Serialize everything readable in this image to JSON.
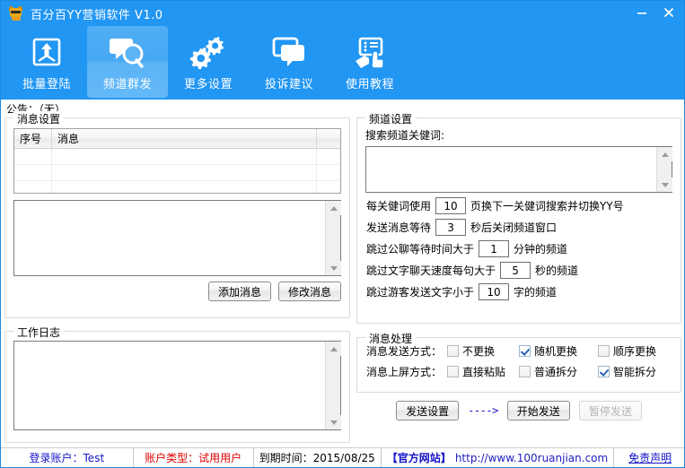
{
  "window": {
    "title": "百分百YY营销软件 V1.0",
    "app_icon": "cat-face-icon",
    "minimize": "minimize-icon",
    "close": "close-icon"
  },
  "toolbar": {
    "items": [
      {
        "label": "批量登陆",
        "icon": "upload-box-icon",
        "selected": false
      },
      {
        "label": "频道群发",
        "icon": "chat-search-icon",
        "selected": true
      },
      {
        "label": "更多设置",
        "icon": "gears-icon",
        "selected": false
      },
      {
        "label": "投诉建议",
        "icon": "speech-bubbles-icon",
        "selected": false
      },
      {
        "label": "使用教程",
        "icon": "hand-screen-icon",
        "selected": false
      }
    ]
  },
  "notice": {
    "text": "公告：（无）"
  },
  "message_settings": {
    "title": "消息设置",
    "table": {
      "columns": [
        "序号",
        "消息",
        ""
      ],
      "rows": [
        [
          "",
          "",
          ""
        ],
        [
          "",
          "",
          ""
        ],
        [
          "",
          "",
          ""
        ]
      ]
    },
    "editor": {
      "value": "",
      "placeholder": ""
    },
    "add_button": "添加消息",
    "edit_button": "修改消息"
  },
  "work_log": {
    "title": "工作日志",
    "value": ""
  },
  "channel_settings": {
    "title": "频道设置",
    "keyword_label": "搜索频道关健词:",
    "keyword_value": "",
    "rows": [
      {
        "prefix": "每关健词使用",
        "value": "10",
        "suffix": "页换下一关健词搜索并切换YY号"
      },
      {
        "prefix": "发送消息等待",
        "value": "3",
        "suffix": "秒后关闭频道窗口"
      },
      {
        "prefix": "跳过公聊等待时间大于",
        "value": "1",
        "suffix": "分钟的频道"
      },
      {
        "prefix": "跳过文字聊天速度每句大于",
        "value": "5",
        "suffix": "秒的频道"
      },
      {
        "prefix": "跳过游客发送文字小于",
        "value": "10",
        "suffix": "字的频道"
      }
    ]
  },
  "message_processing": {
    "title": "消息处理",
    "send_mode": {
      "label": "消息发送方式：",
      "options": [
        {
          "label": "不更换",
          "checked": false
        },
        {
          "label": "随机更换",
          "checked": true
        },
        {
          "label": "顺序更换",
          "checked": false
        }
      ]
    },
    "display_mode": {
      "label": "消息上屏方式：",
      "options": [
        {
          "label": "直接粘贴",
          "checked": false
        },
        {
          "label": "普通拆分",
          "checked": false
        },
        {
          "label": "智能拆分",
          "checked": true
        }
      ]
    },
    "send_settings_button": "发送设置",
    "arrow": "---->",
    "start_button": "开始发送",
    "pause_button": "暂停发送"
  },
  "statusbar": {
    "account": "登录账户：Test",
    "account_type": "账户类型：试用用户",
    "expiry": "到期时间：2015/08/25",
    "site_label": "【官方网站】",
    "site_url": "http://www.100ruanjian.com",
    "disclaimer": "免责声明"
  },
  "colors": {
    "brand_blue": "#2196f3",
    "selected_tab": "#51aef5",
    "link_blue": "#1414c8",
    "warning_red": "#e00000"
  }
}
